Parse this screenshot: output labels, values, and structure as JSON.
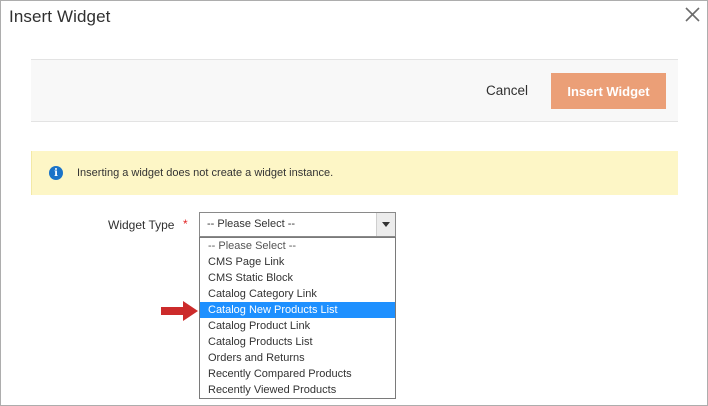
{
  "modal": {
    "title": "Insert Widget"
  },
  "actions": {
    "cancel_label": "Cancel",
    "insert_label": "Insert Widget",
    "insert_color": "#eb9f77"
  },
  "notice": {
    "icon": "info-icon",
    "text": "Inserting a widget does not create a widget instance.",
    "background": "#fdf6c6"
  },
  "form": {
    "widget_type_label": "Widget Type",
    "required_marker": "*",
    "selected_value": "-- Please Select --",
    "options": [
      "-- Please Select --",
      "CMS Page Link",
      "CMS Static Block",
      "Catalog Category Link",
      "Catalog New Products List",
      "Catalog Product Link",
      "Catalog Products List",
      "Orders and Returns",
      "Recently Compared Products",
      "Recently Viewed Products"
    ],
    "highlighted_option": "Catalog New Products List",
    "highlight_color": "#1e90ff"
  },
  "annotation": {
    "pointer": "red-arrow-icon",
    "color": "#cc2b2b"
  }
}
